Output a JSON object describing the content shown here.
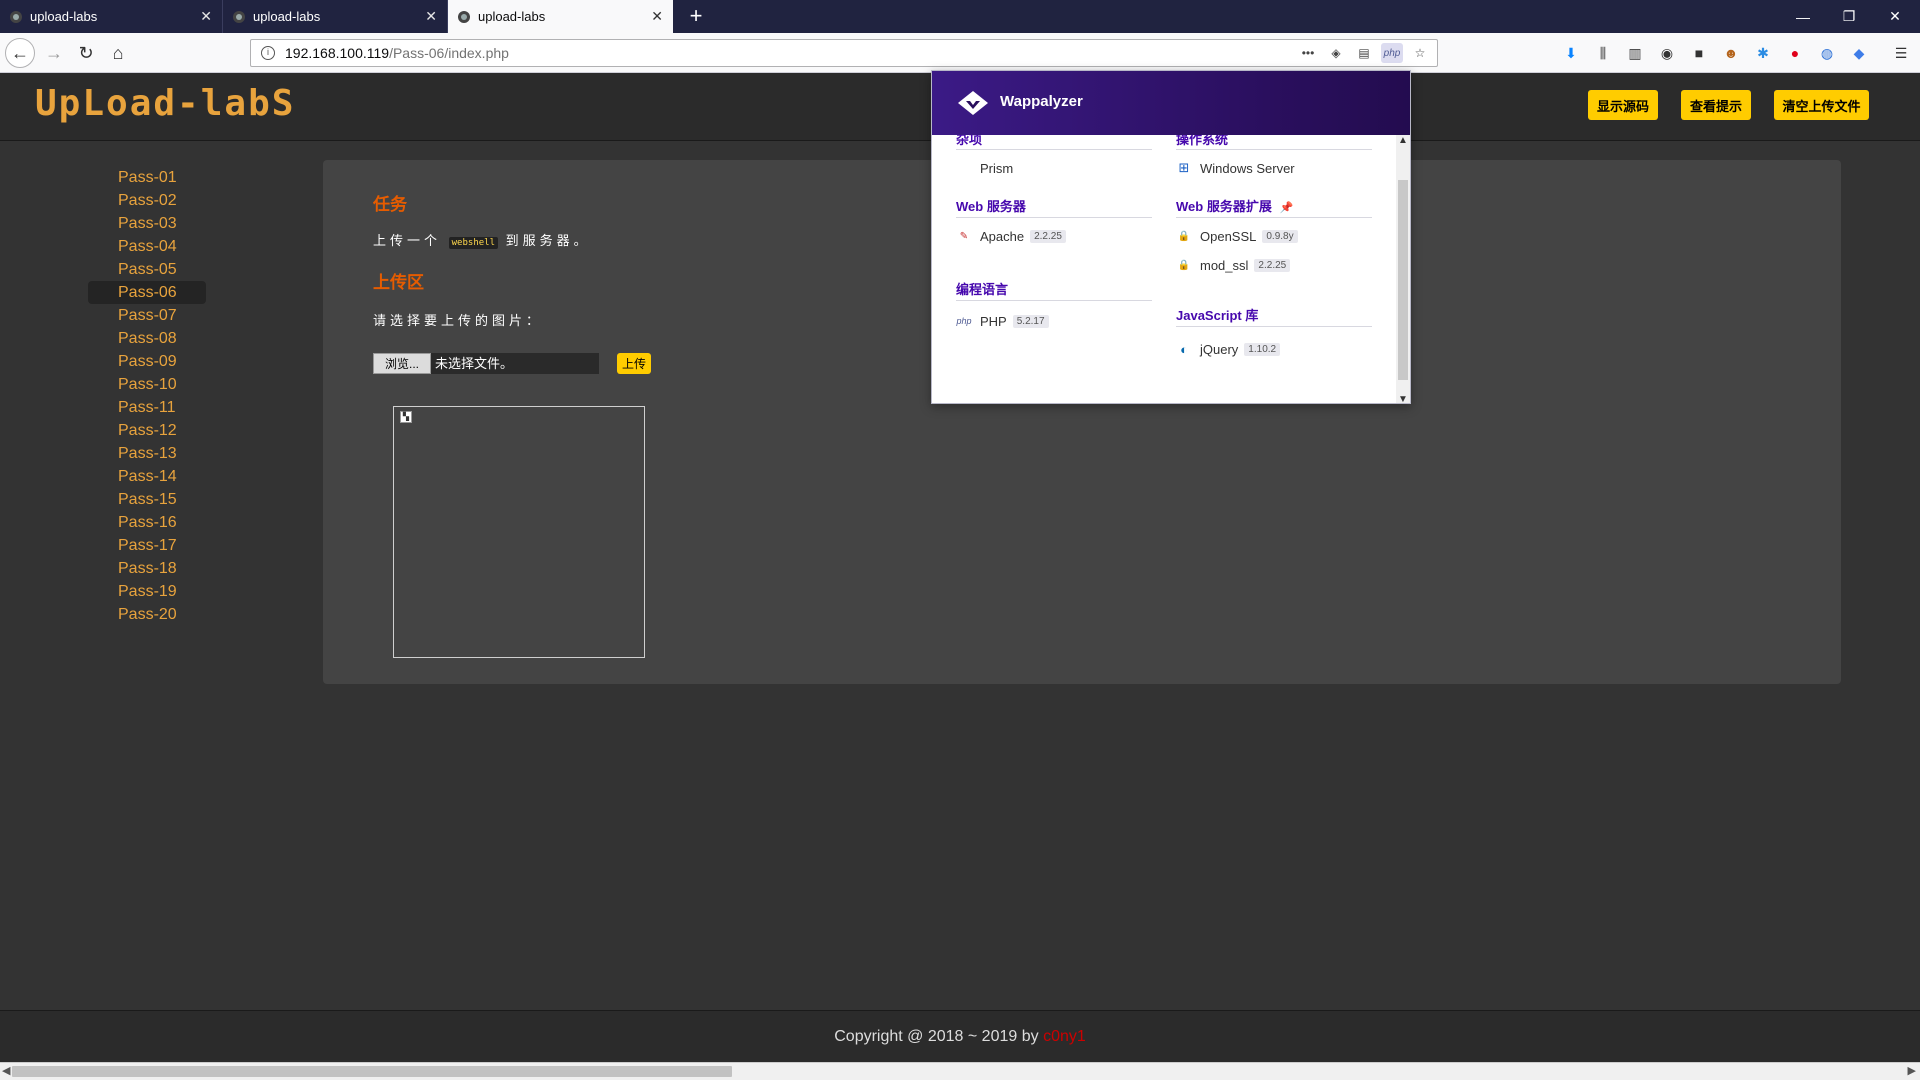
{
  "browser": {
    "tabs": [
      {
        "title": "upload-labs",
        "active": false
      },
      {
        "title": "upload-labs",
        "active": false
      },
      {
        "title": "upload-labs",
        "active": true
      }
    ],
    "new_tab": "+",
    "url_host": "192.168.100.119",
    "url_path": "/Pass-06/index.php",
    "url_more": "•••",
    "php_badge": "php",
    "window_controls": {
      "minimize": "—",
      "restore": "❐",
      "close": "✕"
    }
  },
  "header": {
    "logo": "UpLoad-labS",
    "buttons": {
      "show_source": "显示源码",
      "show_hint": "查看提示",
      "clear_uploads": "清空上传文件"
    }
  },
  "sidebar": {
    "items": [
      "Pass-01",
      "Pass-02",
      "Pass-03",
      "Pass-04",
      "Pass-05",
      "Pass-06",
      "Pass-07",
      "Pass-08",
      "Pass-09",
      "Pass-10",
      "Pass-11",
      "Pass-12",
      "Pass-13",
      "Pass-14",
      "Pass-15",
      "Pass-16",
      "Pass-17",
      "Pass-18",
      "Pass-19",
      "Pass-20"
    ],
    "active_index": 5
  },
  "main": {
    "task_heading": "任务",
    "task_prefix": "上传一个",
    "task_code": "webshell",
    "task_suffix": "到服务器。",
    "upload_heading": "上传区",
    "select_prompt": "请选择要上传的图片：",
    "browse_label": "浏览...",
    "no_file": "未选择文件。",
    "upload_button": "上传"
  },
  "footer": {
    "copyright": "Copyright @ 2018 ~ 2019 by ",
    "author": "c0ny1"
  },
  "wappalyzer": {
    "title": "Wappalyzer",
    "categories": {
      "misc": {
        "label": "杂项",
        "items": [
          {
            "name": "Prism",
            "version": ""
          }
        ]
      },
      "web_servers": {
        "label": "Web 服务器",
        "items": [
          {
            "name": "Apache",
            "version": "2.2.25"
          }
        ]
      },
      "languages": {
        "label": "编程语言",
        "items": [
          {
            "name": "PHP",
            "version": "5.2.17"
          }
        ]
      },
      "os": {
        "label": "操作系统",
        "items": [
          {
            "name": "Windows Server",
            "version": ""
          }
        ]
      },
      "server_ext": {
        "label": "Web 服务器扩展",
        "items": [
          {
            "name": "OpenSSL",
            "version": "0.9.8y"
          },
          {
            "name": "mod_ssl",
            "version": "2.2.25"
          }
        ]
      },
      "js_libs": {
        "label": "JavaScript 库",
        "items": [
          {
            "name": "jQuery",
            "version": "1.10.2"
          }
        ]
      }
    }
  },
  "colors": {
    "accent": "#ffcc00",
    "link": "#e8a33d",
    "heading": "#e65c00",
    "wappalyzer_purple": "#4608ad"
  }
}
